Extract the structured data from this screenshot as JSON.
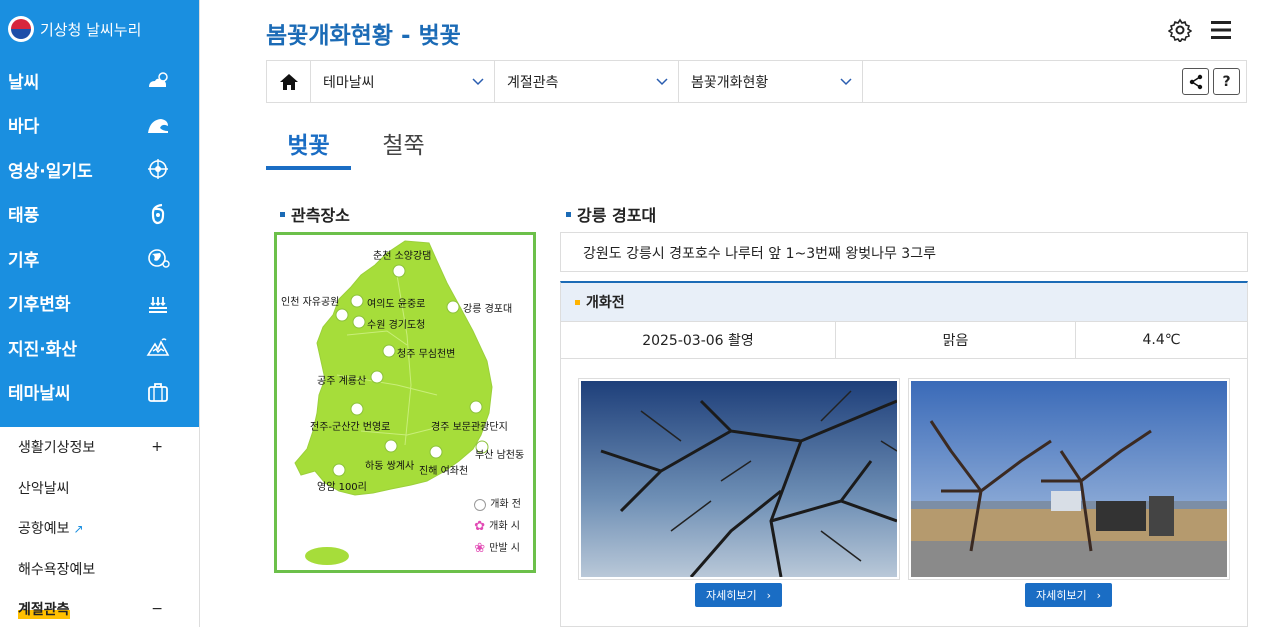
{
  "brand": "기상청 날씨누리",
  "nav": [
    {
      "label": "날씨",
      "icon": "cloud-sun-icon"
    },
    {
      "label": "바다",
      "icon": "wave-icon"
    },
    {
      "label": "영상·일기도",
      "icon": "satellite-icon"
    },
    {
      "label": "태풍",
      "icon": "typhoon-icon"
    },
    {
      "label": "기후",
      "icon": "globe-icon"
    },
    {
      "label": "기후변화",
      "icon": "climate-change-icon"
    },
    {
      "label": "지진·화산",
      "icon": "earthquake-icon"
    },
    {
      "label": "테마날씨",
      "icon": "suitcase-icon"
    }
  ],
  "subnav": [
    {
      "label": "생활기상정보",
      "mark": "+"
    },
    {
      "label": "산악날씨",
      "mark": ""
    },
    {
      "label": "공항예보",
      "mark": ""
    },
    {
      "label": "해수욕장예보",
      "mark": ""
    },
    {
      "label": "계절관측",
      "mark": "−"
    }
  ],
  "page": {
    "title": "봄꽃개화현황 - 벚꽃"
  },
  "breadcrumb": {
    "level1": "테마날씨",
    "level2": "계절관측",
    "level3": "봄꽃개화현황",
    "help": "?"
  },
  "tabs": {
    "tab1": "벚꽃",
    "tab2": "철쭉"
  },
  "map": {
    "title": "관측장소",
    "cities": [
      "춘천 소양강댐",
      "인천 자유공원",
      "여의도 윤중로",
      "수원 경기도청",
      "강릉 경포대",
      "청주 무심천변",
      "공주 계룡산",
      "전주-군산간 번영로",
      "경주 보문관광단지",
      "부산 남천동",
      "하동 쌍계사",
      "진해 여좌천",
      "영암 100리"
    ],
    "legend": {
      "before": "개화 전",
      "bloom": "개화 시",
      "full": "만발 시"
    }
  },
  "location": {
    "title": "강릉 경포대",
    "description": "강원도 강릉시 경포호수 나루터 앞 1~3번째 왕벚나무 3그루"
  },
  "status": {
    "label": "개화전",
    "date": "2025-03-06 촬영",
    "weather": "맑음",
    "temperature": "4.4℃",
    "detail_label": "자세히보기"
  },
  "colors": {
    "primary": "#1a8fe0",
    "title": "#1b6bb6",
    "map_land": "#a6dd3a",
    "map_border": "#6cc04a"
  }
}
